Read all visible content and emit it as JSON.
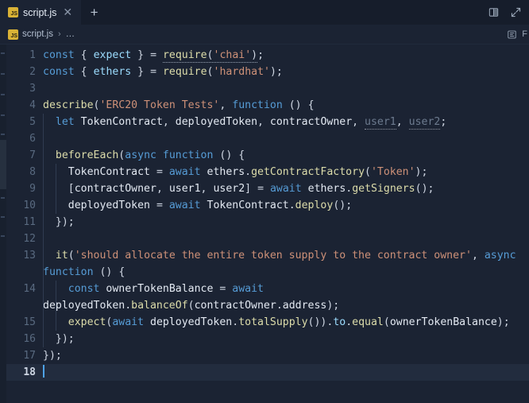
{
  "window": {
    "background": "#1b2333",
    "accent": "#4ea3e8"
  },
  "tabbar": {
    "background": "#161d2b",
    "tabs": [
      {
        "label": "script.js",
        "icon": "js-file-icon",
        "icon_text": "JS",
        "icon_color": "#d9b236",
        "active": true,
        "close_label": "✕"
      }
    ],
    "new_tab_label": "+",
    "actions": [
      {
        "name": "split-editor-right-icon",
        "title": "Split Editor Right"
      },
      {
        "name": "maximize-editor-icon",
        "title": "Toggle Maximize Editor Group"
      }
    ]
  },
  "breadcrumb": {
    "icon": "js-file-icon",
    "icon_text": "JS",
    "file": "script.js",
    "separator": "›",
    "more": "…",
    "outline_icon": "outline-icon",
    "outline_label": "F"
  },
  "editor": {
    "language": "javascript",
    "active_line": 18,
    "cursor_line": 18,
    "cursor_column": 1,
    "line_height": 21,
    "gutter_width": 54,
    "colors": {
      "background": "#1b2333",
      "active_line": "#222c3e",
      "line_number": "#596a80",
      "line_number_active": "#cdd6e3",
      "keyword": "#569cd6",
      "function": "#dcdcaa",
      "string": "#ce9178",
      "variable": "#e3e9f2",
      "property": "#9cdcfe",
      "dimmed": "#6d7b8f",
      "cursor": "#4ea3e8"
    },
    "lines": [
      {
        "number": 1,
        "text": "const { expect } = require('chai');"
      },
      {
        "number": 2,
        "text": "const { ethers } = require('hardhat');"
      },
      {
        "number": 3,
        "text": ""
      },
      {
        "number": 4,
        "text": "describe('ERC20 Token Tests', function () {"
      },
      {
        "number": 5,
        "text": "  let TokenContract, deployedToken, contractOwner, user1, user2;"
      },
      {
        "number": 6,
        "text": ""
      },
      {
        "number": 7,
        "text": "  beforeEach(async function () {"
      },
      {
        "number": 8,
        "text": "    TokenContract = await ethers.getContractFactory('Token');"
      },
      {
        "number": 9,
        "text": "    [contractOwner, user1, user2] = await ethers.getSigners();"
      },
      {
        "number": 10,
        "text": "    deployedToken = await TokenContract.deploy();"
      },
      {
        "number": 11,
        "text": "  });"
      },
      {
        "number": 12,
        "text": ""
      },
      {
        "number": 13,
        "text": "  it('should allocate the entire token supply to the contract owner', async function () {"
      },
      {
        "number": 14,
        "text": "    const ownerTokenBalance = await deployedToken.balanceOf(contractOwner.address);"
      },
      {
        "number": 15,
        "text": "    expect(await deployedToken.totalSupply()).to.equal(ownerTokenBalance);"
      },
      {
        "number": 16,
        "text": "  });"
      },
      {
        "number": 17,
        "text": "});"
      },
      {
        "number": 18,
        "text": ""
      }
    ],
    "diagnostics": [
      {
        "line": 1,
        "token": "require",
        "kind": "squiggle"
      },
      {
        "line": 5,
        "token": "user1",
        "kind": "unused"
      },
      {
        "line": 5,
        "token": "user2",
        "kind": "unused"
      }
    ]
  }
}
